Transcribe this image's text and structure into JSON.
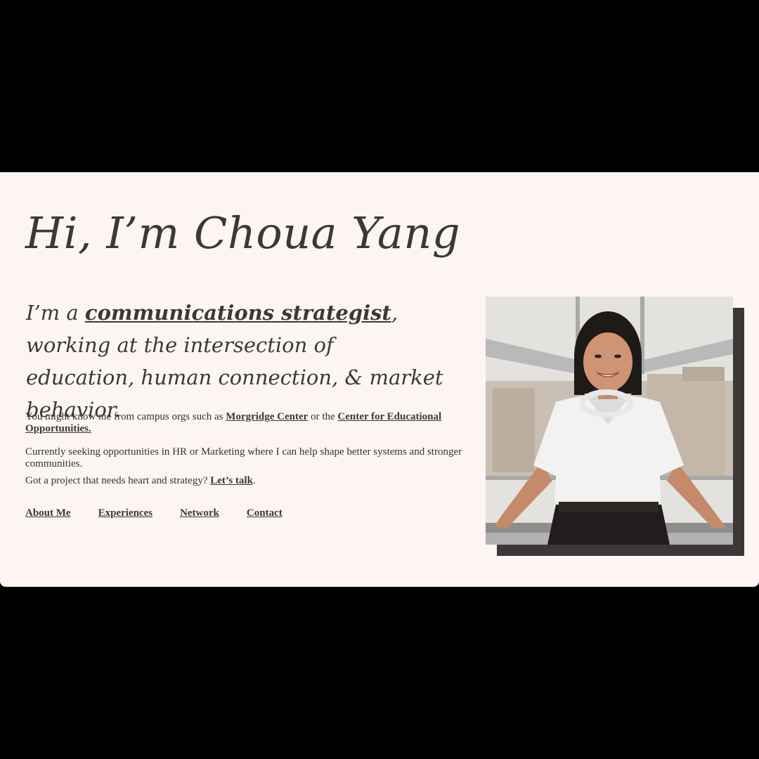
{
  "hero": {
    "heading": "Hi, I’m Choua Yang",
    "tagline_prefix": "I’m a ",
    "tagline_link": "communications strategist",
    "tagline_suffix": ", working at the intersection of education, human connection, & market behavior."
  },
  "bio": {
    "p1_prefix": "You might know me from campus orgs such as ",
    "p1_link1": "Morgridge Center",
    "p1_middle": " or the ",
    "p1_link2": "Center for Educational Opportunities.",
    "p2": "Currently seeking opportunities in HR or Marketing where I can help shape better systems and stronger communities.",
    "p3_prefix": "Got a project that needs heart and strategy? ",
    "p3_link": "Let’s talk",
    "p3_suffix": "."
  },
  "nav": {
    "about": "About Me",
    "experiences": "Experiences",
    "network": "Network",
    "contact": "Contact"
  },
  "colors": {
    "page_background": "#fcf5f3",
    "text": "#3d3838",
    "frame": "#000000"
  }
}
